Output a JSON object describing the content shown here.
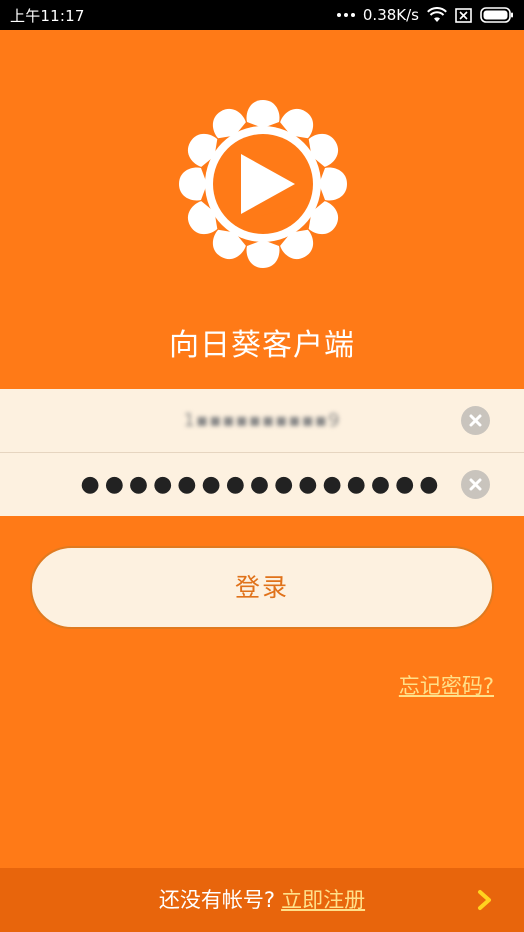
{
  "status_bar": {
    "time": "上午11:17",
    "net_speed": "0.38K/s"
  },
  "app": {
    "title": "向日葵客户端",
    "logo_icon": "sunflower-play-icon",
    "brand_color": "#ff7a17"
  },
  "form": {
    "account_value": "1▪▪▪▪▪▪▪▪▪▪9",
    "password_value": "●●●●●●●●●●●●●●●",
    "login_label": "登录",
    "forgot_label": "忘记密码?"
  },
  "footer": {
    "prompt": "还没有帐号?",
    "register_label": "立即注册"
  }
}
